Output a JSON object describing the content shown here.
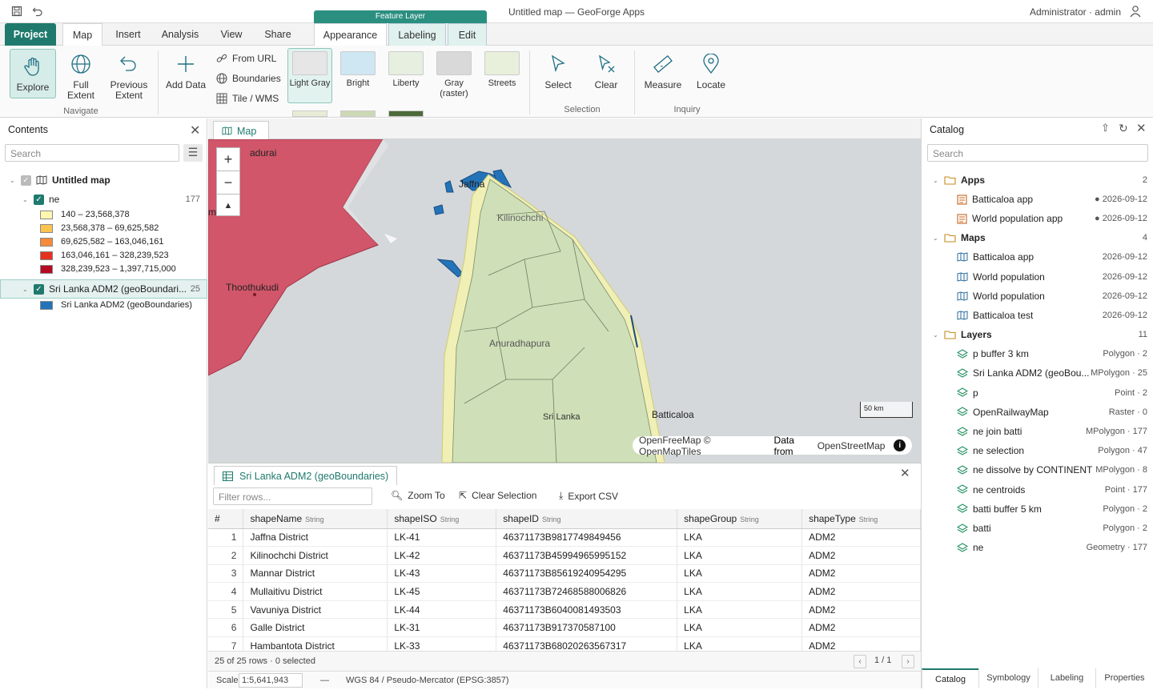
{
  "titlebar": {
    "title": "Untitled map — GeoForge Apps",
    "user": "Administrator · admin"
  },
  "tabs": {
    "project": "Project",
    "map": "Map",
    "insert": "Insert",
    "analysis": "Analysis",
    "view": "View",
    "share": "Share",
    "context_header": "Feature Layer",
    "appearance": "Appearance",
    "labeling": "Labeling",
    "edit": "Edit"
  },
  "ribbon": {
    "explore": "Explore",
    "full_extent": "Full Extent",
    "previous_extent": "Previous Extent",
    "navigate": "Navigate",
    "add_data": "Add Data",
    "from_url": "From URL",
    "boundaries": "Boundaries",
    "tile_wms": "Tile / WMS",
    "styles": [
      {
        "label": "Light Gray",
        "color": "#e6e6e6"
      },
      {
        "label": "Bright",
        "color": "#cfe6f3"
      },
      {
        "label": "Liberty",
        "color": "#e6efe0"
      },
      {
        "label": "Gray (raster)",
        "color": "#d9d9d9"
      },
      {
        "label": "Streets",
        "color": "#e8f0dc"
      }
    ],
    "select": "Select",
    "clear": "Clear",
    "selection": "Selection",
    "measure": "Measure",
    "locate": "Locate",
    "inquiry": "Inquiry"
  },
  "contents": {
    "title": "Contents",
    "search_placeholder": "Search",
    "map_name": "Untitled map",
    "layer_ne": "ne",
    "layer_ne_count": "177",
    "legend": [
      {
        "label": "140 – 23,568,378",
        "color": "#fff7b0"
      },
      {
        "label": "23,568,378 – 69,625,582",
        "color": "#fdc34f"
      },
      {
        "label": "69,625,582 – 163,046,161",
        "color": "#f58a3a"
      },
      {
        "label": "163,046,161 – 328,239,523",
        "color": "#e5311e"
      },
      {
        "label": "328,239,523 – 1,397,715,000",
        "color": "#b50b22"
      }
    ],
    "layer_sl": "Sri Lanka ADM2 (geoBoundari...",
    "layer_sl_count": "25",
    "layer_sl_legend": "Sri Lanka ADM2 (geoBoundaries)",
    "layer_sl_color": "#2473b8"
  },
  "map": {
    "tab": "Map",
    "labels": {
      "madurai": "adurai",
      "thoothukudi": "Thoothukudi",
      "jaffna": "Jaffna",
      "kilinochchi": "Kilinochchi",
      "anuradhapura": "Anuradhapura",
      "srilanka": "Sri Lanka",
      "batticaloa": "Batticaloa",
      "m": "m"
    },
    "scale_label": "50 km",
    "attribution_1": "OpenFreeMap © OpenMapTiles",
    "attribution_2": "Data from",
    "attribution_3": "OpenStreetMap"
  },
  "table": {
    "tab": "Sri Lanka ADM2 (geoBoundaries)",
    "filter_placeholder": "Filter rows...",
    "zoom_to": "Zoom To",
    "clear_selection": "Clear Selection",
    "export_csv": "Export CSV",
    "columns": [
      {
        "name": "#",
        "type": ""
      },
      {
        "name": "shapeName",
        "type": "String"
      },
      {
        "name": "shapeISO",
        "type": "String"
      },
      {
        "name": "shapeID",
        "type": "String"
      },
      {
        "name": "shapeGroup",
        "type": "String"
      },
      {
        "name": "shapeType",
        "type": "String"
      }
    ],
    "rows": [
      [
        "1",
        "Jaffna District",
        "LK-41",
        "46371173B9817749849456",
        "LKA",
        "ADM2"
      ],
      [
        "2",
        "Kilinochchi District",
        "LK-42",
        "46371173B45994965995152",
        "LKA",
        "ADM2"
      ],
      [
        "3",
        "Mannar District",
        "LK-43",
        "46371173B85619240954295",
        "LKA",
        "ADM2"
      ],
      [
        "4",
        "Mullaitivu District",
        "LK-45",
        "46371173B72468588006826",
        "LKA",
        "ADM2"
      ],
      [
        "5",
        "Vavuniya District",
        "LK-44",
        "46371173B6040081493503",
        "LKA",
        "ADM2"
      ],
      [
        "6",
        "Galle District",
        "LK-31",
        "46371173B917370587100",
        "LKA",
        "ADM2"
      ],
      [
        "7",
        "Hambantota District",
        "LK-33",
        "46371173B68020263567317",
        "LKA",
        "ADM2"
      ]
    ],
    "footer": "25 of 25 rows · 0 selected",
    "pager": "1 / 1"
  },
  "status": {
    "scale_label": "Scale",
    "scale_value": "1:5,641,943",
    "dash": "—",
    "crs": "WGS 84 / Pseudo-Mercator (EPSG:3857)"
  },
  "catalog": {
    "title": "Catalog",
    "search_placeholder": "Search",
    "groups": [
      {
        "name": "Apps",
        "count": "2",
        "items": [
          {
            "name": "Batticaloa app",
            "meta": "● 2026-09-12"
          },
          {
            "name": "World population app",
            "meta": "● 2026-09-12"
          }
        ]
      },
      {
        "name": "Maps",
        "count": "4",
        "items": [
          {
            "name": "Batticaloa app",
            "meta": "2026-09-12"
          },
          {
            "name": "World population",
            "meta": "2026-09-12"
          },
          {
            "name": "World population",
            "meta": "2026-09-12"
          },
          {
            "name": "Batticaloa test",
            "meta": "2026-09-12"
          }
        ]
      },
      {
        "name": "Layers",
        "count": "11",
        "items": [
          {
            "name": "p buffer 3 km",
            "meta": "Polygon · 2"
          },
          {
            "name": "Sri Lanka ADM2 (geoBou...",
            "meta": "MPolygon · 25"
          },
          {
            "name": "p",
            "meta": "Point · 2"
          },
          {
            "name": "OpenRailwayMap",
            "meta": "Raster · 0"
          },
          {
            "name": "ne join batti",
            "meta": "MPolygon · 177"
          },
          {
            "name": "ne selection",
            "meta": "Polygon · 47"
          },
          {
            "name": "ne dissolve by CONTINENT",
            "meta": "MPolygon · 8"
          },
          {
            "name": "ne centroids",
            "meta": "Point · 177"
          },
          {
            "name": "batti buffer 5 km",
            "meta": "Polygon · 2"
          },
          {
            "name": "batti",
            "meta": "Polygon · 2"
          },
          {
            "name": "ne",
            "meta": "Geometry · 177"
          }
        ]
      }
    ],
    "bottom_tabs": [
      "Catalog",
      "Symbology",
      "Labeling",
      "Properties"
    ]
  },
  "colors": {
    "accent": "#1f7a6d",
    "india_fill": "#d1566a",
    "srilanka_fill": "#cfe0b8",
    "adm2_blue": "#2473b8"
  }
}
